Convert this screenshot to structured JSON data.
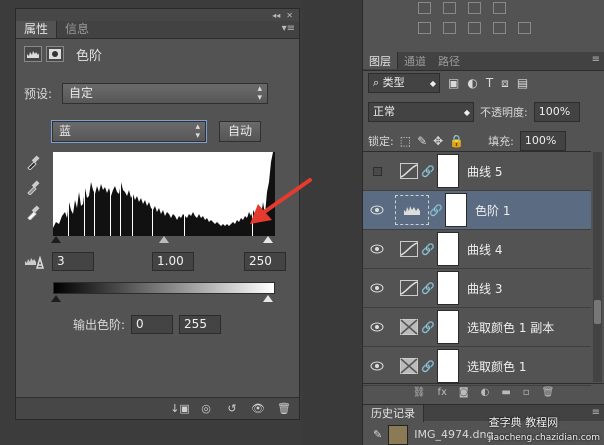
{
  "properties": {
    "tabs": [
      "属性",
      "信息"
    ],
    "header_title": "色阶",
    "preset_label": "预设:",
    "preset_value": "自定",
    "channel_value": "蓝",
    "auto_button": "自动",
    "input_black": "3",
    "input_gamma": "1.00",
    "input_white": "250",
    "output_label": "输出色阶:",
    "output_black": "0",
    "output_white": "255"
  },
  "layers_panel": {
    "tabs": [
      "图层",
      "通道",
      "路径"
    ],
    "filter_label": "类型",
    "blend_mode": "正常",
    "opacity_label": "不透明度:",
    "opacity_value": "100%",
    "lock_label": "锁定:",
    "fill_label": "填充:",
    "fill_value": "100%",
    "layers": [
      {
        "name": "曲线 5",
        "visible": false,
        "kind": "curves",
        "selected": false
      },
      {
        "name": "色阶 1",
        "visible": true,
        "kind": "levels",
        "selected": true
      },
      {
        "name": "曲线 4",
        "visible": true,
        "kind": "curves",
        "selected": false
      },
      {
        "name": "曲线 3",
        "visible": true,
        "kind": "curves",
        "selected": false
      },
      {
        "name": "选取颜色 1 副本",
        "visible": true,
        "kind": "selective-color",
        "selected": false
      },
      {
        "name": "选取颜色 1",
        "visible": true,
        "kind": "selective-color",
        "selected": false
      }
    ]
  },
  "history": {
    "tab": "历史记录",
    "item": "IMG_4974.dng"
  },
  "watermark": "查字典 教程网",
  "watermark_url": "jiaocheng.chazidian.com",
  "colors": {
    "accent_arrow": "#e53a2e",
    "selected_layer": "#5a6b82",
    "panel_bg": "#535353"
  }
}
